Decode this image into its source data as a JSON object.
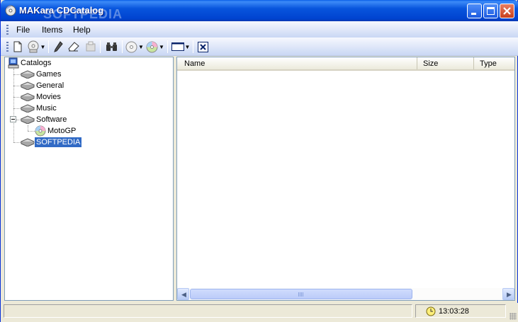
{
  "window": {
    "title": "MAKara CDCatalog",
    "watermark": "SOFTPEDIA"
  },
  "menu": [
    {
      "label": "File"
    },
    {
      "label": "Items"
    },
    {
      "label": "Help"
    }
  ],
  "toolbar": {
    "buttons": [
      "new-icon",
      "catalog-disk-icon",
      "edit-pencil-icon",
      "eraser-icon",
      "properties-icon",
      "find-binoculars-icon",
      "cd-icon",
      "color-cd-icon",
      "view-icon",
      "close-x-icon"
    ]
  },
  "tree": {
    "root": {
      "label": "Catalogs",
      "icon": "computer-icon"
    },
    "items": [
      {
        "label": "Games",
        "icon": "drive-icon"
      },
      {
        "label": "General",
        "icon": "drive-icon"
      },
      {
        "label": "Movies",
        "icon": "drive-icon"
      },
      {
        "label": "Music",
        "icon": "drive-icon"
      },
      {
        "label": "Software",
        "icon": "drive-icon",
        "expanded": true,
        "children": [
          {
            "label": "MotoGP",
            "icon": "cd-icon"
          }
        ]
      },
      {
        "label": "SOFTPEDIA",
        "icon": "drive-icon",
        "selected": true
      }
    ]
  },
  "list": {
    "columns": [
      {
        "label": "Name"
      },
      {
        "label": "Size"
      },
      {
        "label": "Type"
      }
    ],
    "rows": []
  },
  "status": {
    "text": "",
    "time": "13:03:28"
  },
  "colors": {
    "titlebar": "#0855dd",
    "selection": "#316ac5",
    "window_bg": "#ece9d8"
  }
}
